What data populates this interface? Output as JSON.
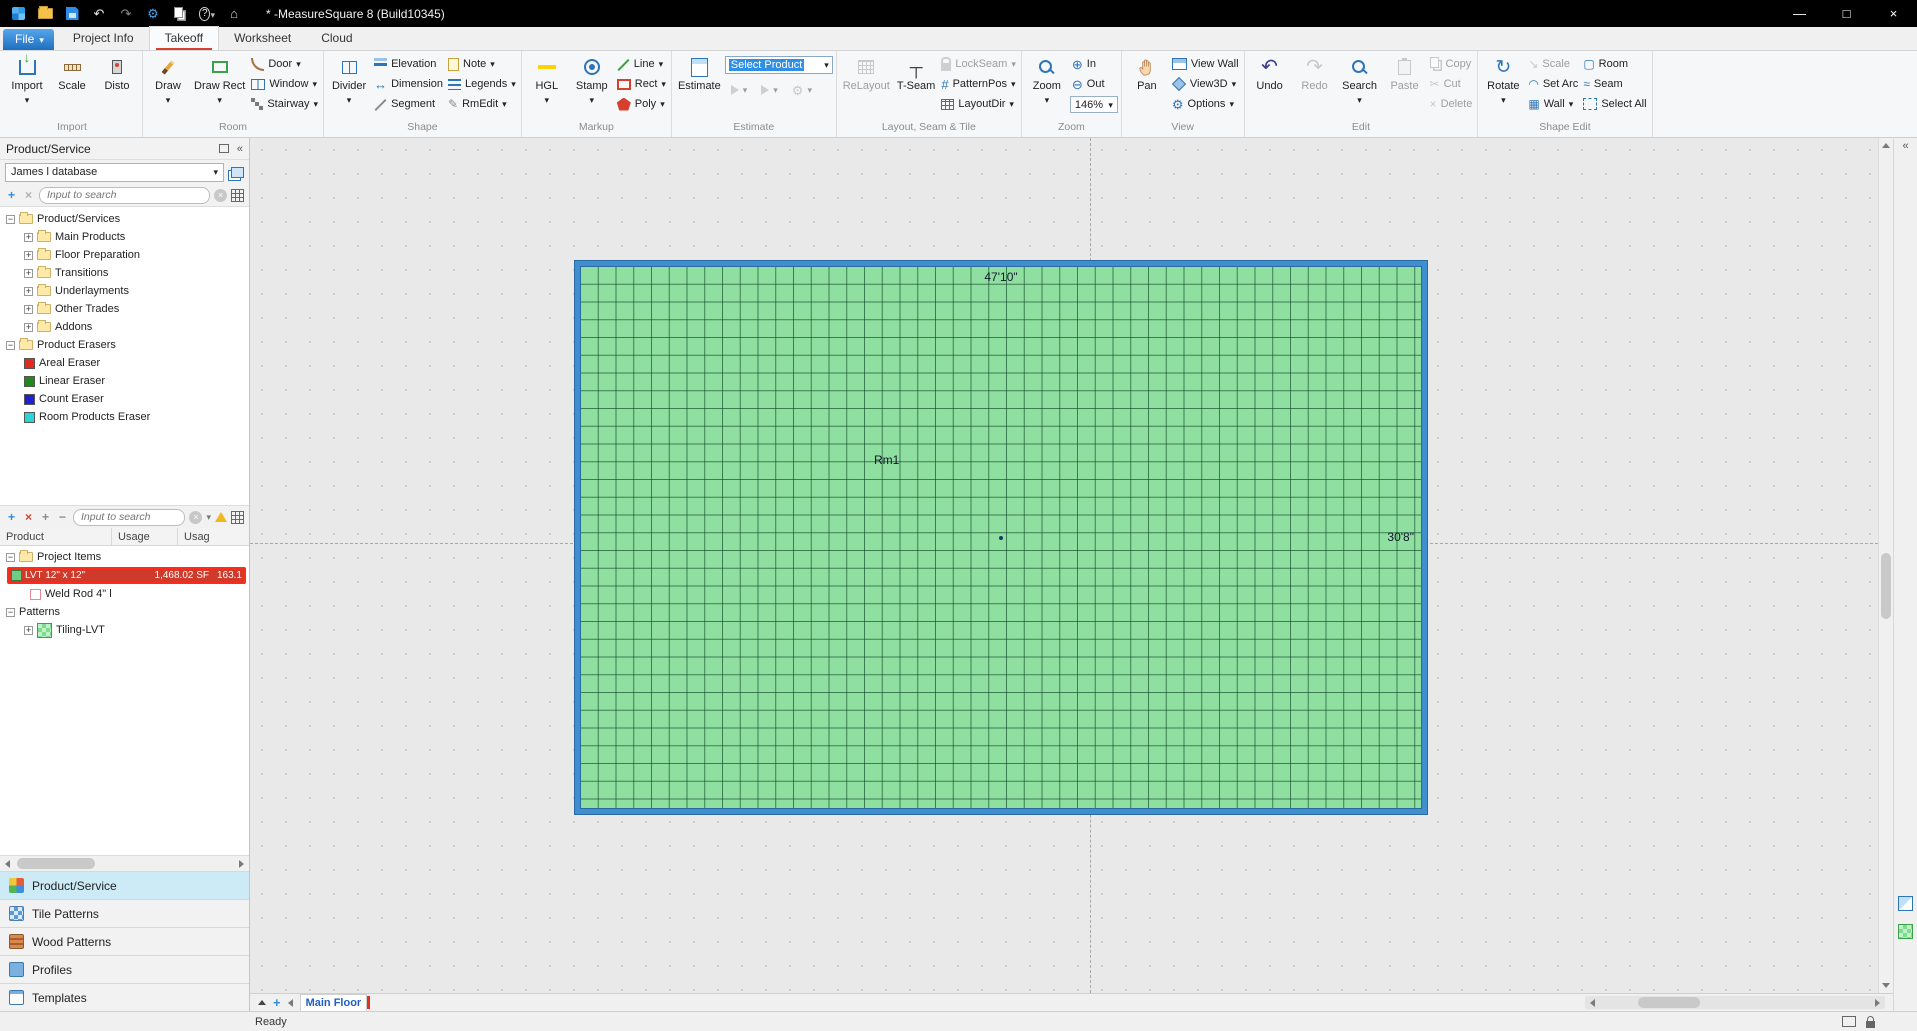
{
  "colors": {
    "accent_blue": "#2e8be6",
    "room_fill": "#8fe0a0",
    "room_border": "#3e8ed0",
    "selected_red": "#e03224",
    "file_button_blue": "#1f6fc0"
  },
  "titlebar": {
    "title": "* -MeasureSquare 8 (Build10345)",
    "help": "?",
    "controls": {
      "minimize": "—",
      "maximize": "□",
      "close": "×"
    }
  },
  "menu": {
    "file": "File",
    "tabs": [
      "Project Info",
      "Takeoff",
      "Worksheet",
      "Cloud"
    ],
    "active_tab": "Takeoff"
  },
  "ribbon": {
    "groups": [
      {
        "label": "Import",
        "buttons": [
          {
            "label": "Import"
          },
          {
            "label": "Scale"
          },
          {
            "label": "Disto"
          }
        ]
      },
      {
        "label": "Room",
        "big": [
          {
            "label": "Draw"
          },
          {
            "label": "Draw Rect"
          }
        ],
        "small": [
          {
            "label": "Door"
          },
          {
            "label": "Window"
          },
          {
            "label": "Stairway"
          }
        ]
      },
      {
        "label": "Shape",
        "big": [
          {
            "label": "Divider"
          }
        ],
        "smallA": [
          {
            "label": "Elevation"
          },
          {
            "label": "Dimension"
          },
          {
            "label": "Segment"
          }
        ],
        "smallB": [
          {
            "label": "Note"
          },
          {
            "label": "Legends"
          },
          {
            "label": "RmEdit"
          }
        ]
      },
      {
        "label": "Markup",
        "big": [
          {
            "label": "HGL"
          },
          {
            "label": "Stamp"
          }
        ],
        "small": [
          {
            "label": "Line"
          },
          {
            "label": "Rect"
          },
          {
            "label": "Poly"
          }
        ]
      },
      {
        "label": "Estimate",
        "big": [
          {
            "label": "Estimate"
          }
        ],
        "select_value": "Select Product"
      },
      {
        "label": "Layout, Seam & Tile",
        "big": [
          {
            "label": "ReLayout"
          },
          {
            "label": "T-Seam"
          }
        ],
        "small": [
          {
            "label": "LockSeam"
          },
          {
            "label": "PatternPos"
          },
          {
            "label": "LayoutDir"
          }
        ]
      },
      {
        "label": "Zoom",
        "big": [
          {
            "label": "Zoom"
          }
        ],
        "small": [
          {
            "label": "In"
          },
          {
            "label": "Out"
          }
        ],
        "zoom_value": "146%"
      },
      {
        "label": "View",
        "big": [
          {
            "label": "Pan"
          }
        ],
        "small": [
          {
            "label": "View Wall"
          },
          {
            "label": "View3D"
          },
          {
            "label": "Options"
          }
        ]
      },
      {
        "label": "Edit",
        "big": [
          {
            "label": "Undo"
          },
          {
            "label": "Redo"
          },
          {
            "label": "Search"
          },
          {
            "label": "Paste"
          }
        ],
        "small": [
          {
            "label": "Copy"
          },
          {
            "label": "Cut"
          },
          {
            "label": "Delete"
          }
        ]
      },
      {
        "label": "Shape Edit",
        "big": [
          {
            "label": "Rotate"
          }
        ],
        "smallA": [
          {
            "label": "Scale"
          },
          {
            "label": "Set Arc"
          },
          {
            "label": "Wall"
          }
        ],
        "smallB": [
          {
            "label": "Room"
          },
          {
            "label": "Seam"
          },
          {
            "label": "Select All"
          }
        ]
      }
    ]
  },
  "panel": {
    "title": "Product/Service",
    "database": "James l database",
    "search_placeholder": "Input to search",
    "tree": [
      {
        "label": "Product/Services"
      },
      {
        "label": "Main Products"
      },
      {
        "label": "Floor Preparation"
      },
      {
        "label": "Transitions"
      },
      {
        "label": "Underlayments"
      },
      {
        "label": "Other Trades"
      },
      {
        "label": "Addons"
      },
      {
        "label": "Product Erasers"
      },
      {
        "label": "Areal Eraser",
        "color": "#e02b1f"
      },
      {
        "label": "Linear Eraser",
        "color": "#1e8a1e"
      },
      {
        "label": "Count Eraser",
        "color": "#2222cc"
      },
      {
        "label": "Room Products Eraser",
        "color": "#28d6d6"
      }
    ],
    "table_headers": [
      "Product",
      "Usage",
      "Usag"
    ],
    "items": {
      "root": "Project Items",
      "lvt": {
        "name": "LVT 12\" x 12\"",
        "area": "1,468.02 SF",
        "count": "163.1"
      },
      "weld": "Weld Rod 4\" l",
      "patterns_root": "Patterns",
      "pattern": "Tiling-LVT"
    },
    "nav": [
      {
        "label": "Product/Service"
      },
      {
        "label": "Tile Patterns"
      },
      {
        "label": "Wood Patterns"
      },
      {
        "label": "Profiles"
      },
      {
        "label": "Templates"
      }
    ]
  },
  "canvas": {
    "room_label": "Rm1",
    "width_dim": "47'10\"",
    "height_dim": "30'8\"",
    "room_fill": "#8fe0a0",
    "room_border": "#3e8ed0"
  },
  "sheetbar": {
    "tab": "Main Floor"
  },
  "statusbar": {
    "text": "Ready"
  }
}
